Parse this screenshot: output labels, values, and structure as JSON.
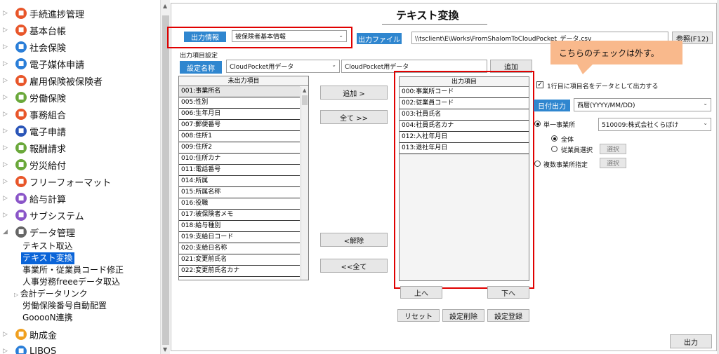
{
  "sidebar": {
    "items": [
      {
        "label": "手続進捗管理",
        "icon": "progress-icon",
        "color": "#e8562a"
      },
      {
        "label": "基本台帳",
        "icon": "ledger-icon",
        "color": "#e8562a"
      },
      {
        "label": "社会保険",
        "icon": "social-insurance-icon",
        "color": "#2a7ed8"
      },
      {
        "label": "電子媒体申請",
        "icon": "search-icon",
        "color": "#2a7ed8"
      },
      {
        "label": "雇用保険被保険者",
        "icon": "employment-insurance-icon",
        "color": "#e8562a"
      },
      {
        "label": "労働保険",
        "icon": "labor-insurance-icon",
        "color": "#6aa83a"
      },
      {
        "label": "事務組合",
        "icon": "association-icon",
        "color": "#e8562a"
      },
      {
        "label": "電子申請",
        "icon": "e-application-icon",
        "color": "#2a55b8"
      },
      {
        "label": "報酬請求",
        "icon": "billing-icon",
        "color": "#6aa83a"
      },
      {
        "label": "労災給付",
        "icon": "accident-benefit-icon",
        "color": "#6aa83a"
      },
      {
        "label": "フリーフォーマット",
        "icon": "free-format-icon",
        "color": "#e8562a"
      },
      {
        "label": "給与計算",
        "icon": "payroll-icon",
        "color": "#8a55c8"
      },
      {
        "label": "サブシステム",
        "icon": "subsystem-icon",
        "color": "#8a55c8"
      },
      {
        "label": "データ管理",
        "icon": "data-management-icon",
        "color": "#666666"
      }
    ],
    "sub_items": [
      {
        "label": "テキスト取込"
      },
      {
        "label": "テキスト変換"
      },
      {
        "label": "事業所・従業員コード修正"
      },
      {
        "label": "人事労務freeeデータ取込"
      },
      {
        "label": "会計データリンク"
      },
      {
        "label": "労働保険番号自動配置"
      },
      {
        "label": "GooooN連携"
      }
    ],
    "bottom_items": [
      {
        "label": "助成金",
        "icon": "subsidy-icon",
        "color": "#f0a020"
      },
      {
        "label": "LIBOS",
        "icon": "libos-icon",
        "color": "#2a7ed8"
      }
    ]
  },
  "main": {
    "title": "テキスト変換",
    "output_info_label": "出力情報",
    "output_info_value": "被保険者基本情報",
    "output_file_label": "出力ファイル",
    "output_file_path": "\\\\tsclient\\E\\Works\\FromShalomToCloudPocket_データ.csv",
    "browse_label": "参照(F12)",
    "group_label": "出力項目設定",
    "setting_name_label": "設定名称",
    "setting_name_value": "CloudPocket用データ",
    "setting_name_text": "CloudPocket用データ",
    "add_setting_label": "追加",
    "unoutput_header": "未出力項目",
    "unoutput_items": [
      "001:事業所名",
      "005:性別",
      "006:生年月日",
      "007:郵便番号",
      "008:住所1",
      "009:住所2",
      "010:住所カナ",
      "011:電話番号",
      "014:所属",
      "015:所属名称",
      "016:役職",
      "017:被保険者メモ",
      "018:給与種別",
      "019:支給日コード",
      "020:支給日名称",
      "021:変更前氏名",
      "022:変更前氏名カナ"
    ],
    "add_btn": "追加 >",
    "add_all_btn": "全て >>",
    "remove_btn": "<解除",
    "remove_all_btn": "<<全て",
    "output_header": "出力項目",
    "output_items": [
      "000:事業所コード",
      "002:従業員コード",
      "003:社員氏名",
      "004:社員氏名カナ",
      "012:入社年月日",
      "013:退社年月日"
    ],
    "up_btn": "上へ",
    "down_btn": "下へ",
    "reset_btn": "リセット",
    "delete_setting_btn": "設定削除",
    "register_setting_btn": "設定登録",
    "first_row_checkbox": "1行目に項目名をデータとして出力する",
    "date_output_label": "日付出力",
    "date_output_value": "西暦(YYYY/MM/DD)",
    "single_office_label": "単一事業所",
    "single_office_value": "510009:株式会社くらぼけ",
    "all_label": "全体",
    "employee_select_label": "従業員選択",
    "select_btn": "選択",
    "multi_office_label": "複数事業所指定",
    "select_btn2": "選択",
    "output_btn": "出力",
    "callout": "こちらのチェックは外す。"
  }
}
